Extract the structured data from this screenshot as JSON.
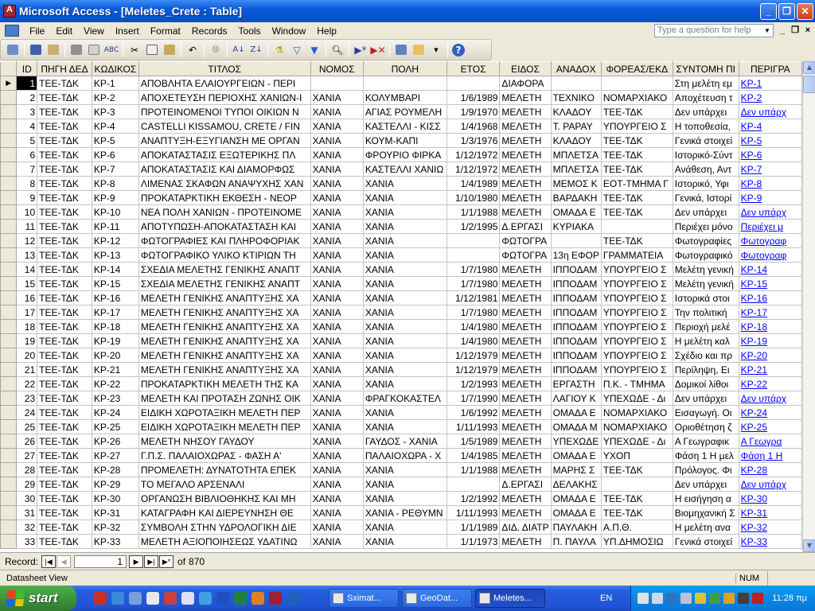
{
  "window": {
    "title": "Microsoft Access - [Meletes_Crete : Table]"
  },
  "menu": {
    "items": [
      "File",
      "Edit",
      "View",
      "Insert",
      "Format",
      "Records",
      "Tools",
      "Window",
      "Help"
    ],
    "ask_placeholder": "Type a question for help"
  },
  "table": {
    "columns": [
      "ID",
      "ΠΗΓΗ ΔΕΔ",
      "ΚΩΔΙΚΟΣ",
      "ΤΙΤΛΟΣ",
      "ΝΟΜΟΣ",
      "ΠΟΛΗ",
      "ΕΤΟΣ",
      "ΕΙΔΟΣ",
      "ΑΝΑΔΟΧ",
      "ΦΟΡΕΑΣ/ΕΚΔ",
      "ΣΥΝΤΟΜΗ ΠΙ",
      "ΠΕΡΙΓΡΑ"
    ],
    "rows": [
      [
        "1",
        "ΤΕΕ-ΤΔΚ",
        "ΚΡ-1",
        "ΑΠΟΒΛΗΤΑ ΕΛΑΙΟΥΡΓΕΙΩΝ - ΠΕΡΙ",
        "",
        "",
        "",
        "ΔΙΑΦΟΡΑ",
        "",
        "",
        "Στη μελέτη εμ",
        "ΚΡ-1"
      ],
      [
        "2",
        "ΤΕΕ-ΤΔΚ",
        "ΚΡ-2",
        "ΑΠΟΧΕΤΕΥΣΗ ΠΕΡΙΟΧΗΣ ΧΑΝΙΩΝ-Ι",
        "ΧΑΝΙΑ",
        "ΚΟΛΥΜΒΑΡΙ",
        "1/6/1989",
        "ΜΕΛΕΤΗ",
        "ΤΕΧΝΙΚΟ",
        "ΝΟΜΑΡΧΙΑΚΟ",
        "Αποχέτευση τ",
        "ΚΡ-2"
      ],
      [
        "3",
        "ΤΕΕ-ΤΔΚ",
        "ΚΡ-3",
        "ΠΡΟΤΕΙΝΟΜΕΝΟΙ ΤΥΠΟΙ ΟΙΚΙΩΝ Ν",
        "ΧΑΝΙΑ",
        "ΑΓΙΑΣ ΡΟΥΜΕΛΗ",
        "1/9/1970",
        "ΜΕΛΕΤΗ",
        "ΚΛΑΔΟΥ",
        "ΤΕΕ-ΤΔΚ",
        "Δεν υπάρχει",
        "Δεν υπάρχ"
      ],
      [
        "4",
        "ΤΕΕ-ΤΔΚ",
        "ΚΡ-4",
        "CASTELLI KISSAMOU, CRETE / FIN",
        "ΧΑΝΙΑ",
        "ΚΑΣΤΕΛΛΙ - ΚΙΣΣ",
        "1/4/1968",
        "ΜΕΛΕΤΗ",
        "Τ. ΡΑΡΑΥ",
        "ΥΠΟΥΡΓΕΙΟ Σ",
        "Η τοποθεσία,",
        "ΚΡ-4"
      ],
      [
        "5",
        "ΤΕΕ-ΤΔΚ",
        "ΚΡ-5",
        "ΑΝΑΠΤΥΞΗ-ΕΞΥΓΙΑΝΣΗ ΜΕ ΟΡΓΑΝ",
        "ΧΑΝΙΑ",
        "ΚΟΥΜ-ΚΑΠΙ",
        "1/3/1976",
        "ΜΕΛΕΤΗ",
        "ΚΛΑΔΟΥ",
        "ΤΕΕ-ΤΔΚ",
        "Γενικά στοιχεί",
        "ΚΡ-5"
      ],
      [
        "6",
        "ΤΕΕ-ΤΔΚ",
        "ΚΡ-6",
        "ΑΠΟΚΑΤΑΣΤΑΣΙΣ ΕΞΩΤΕΡΙΚΗΣ ΠΛ",
        "ΧΑΝΙΑ",
        "ΦΡΟΥΡΙΟ ΦΙΡΚΑ",
        "1/12/1972",
        "ΜΕΛΕΤΗ",
        "ΜΠΛΕΤΣΑ",
        "ΤΕΕ-ΤΔΚ",
        "Ιστορικό-Σύντ",
        "ΚΡ-6"
      ],
      [
        "7",
        "ΤΕΕ-ΤΔΚ",
        "ΚΡ-7",
        "ΑΠΟΚΑΤΑΣΤΑΣΙΣ ΚΑΙ ΔΙΑΜΟΡΦΩΣ",
        "ΧΑΝΙΑ",
        "ΚΑΣΤΕΛΛΙ ΧΑΝΙΩ",
        "1/12/1972",
        "ΜΕΛΕΤΗ",
        "ΜΠΛΕΤΣΑ",
        "ΤΕΕ-ΤΔΚ",
        "Ανάθεση, Αντ",
        "ΚΡ-7"
      ],
      [
        "8",
        "ΤΕΕ-ΤΔΚ",
        "ΚΡ-8",
        "ΛΙΜΕΝΑΣ ΣΚΑΦΩΝ ΑΝΑΨΥΧΗΣ ΧΑΝ",
        "ΧΑΝΙΑ",
        "ΧΑΝΙΑ",
        "1/4/1989",
        "ΜΕΛΕΤΗ",
        "ΜΕΜΟΣ Κ",
        "ΕΟΤ-ΤΜΗΜΑ Γ",
        "Ιστορικό, Υφι",
        "ΚΡ-8"
      ],
      [
        "9",
        "ΤΕΕ-ΤΔΚ",
        "ΚΡ-9",
        "ΠΡΟΚΑΤΑΡΚΤΙΚΗ ΕΚΘΕΣΗ - ΝΕΟΡ",
        "ΧΑΝΙΑ",
        "ΧΑΝΙΑ",
        "1/10/1980",
        "ΜΕΛΕΤΗ",
        "ΒΑΡΔΑΚΗ",
        "ΤΕΕ-ΤΔΚ",
        "Γενικά, Ιστορί",
        "ΚΡ-9"
      ],
      [
        "10",
        "ΤΕΕ-ΤΔΚ",
        "ΚΡ-10",
        "ΝΕΑ ΠΟΛΗ ΧΑΝΙΩΝ - ΠΡΟΤΕΙΝΟΜΕ",
        "ΧΑΝΙΑ",
        "ΧΑΝΙΑ",
        "1/1/1988",
        "ΜΕΛΕΤΗ",
        "ΟΜΑΔΑ Ε",
        "ΤΕΕ-ΤΔΚ",
        "Δεν υπάρχει",
        "Δεν υπάρχ"
      ],
      [
        "11",
        "ΤΕΕ-ΤΔΚ",
        "ΚΡ-11",
        "ΑΠΟΤΥΠΩΣΗ-ΑΠΟΚΑΤΑΣΤΑΣΗ ΚΑΙ",
        "ΧΑΝΙΑ",
        "ΧΑΝΙΑ",
        "1/2/1995",
        "Δ.ΕΡΓΑΣΙ",
        "ΚΥΡΙΑΚΑ",
        "",
        "Περιέχει μόνο",
        "Περιέχει μ"
      ],
      [
        "12",
        "ΤΕΕ-ΤΔΚ",
        "ΚΡ-12",
        "ΦΩΤΟΓΡΑΦΙΕΣ ΚΑΙ ΠΛΗΡΟΦΟΡΙΑΚ",
        "ΧΑΝΙΑ",
        "ΧΑΝΙΑ",
        "",
        "ΦΩΤΟΓΡΑ",
        "",
        "ΤΕΕ-ΤΔΚ",
        "Φωτογραφίες",
        "Φωτογραφ"
      ],
      [
        "13",
        "ΤΕΕ-ΤΔΚ",
        "ΚΡ-13",
        "ΦΩΤΟΓΡΑΦΙΚΟ ΥΛΙΚΟ ΚΤΙΡΙΩΝ ΤΗ",
        "ΧΑΝΙΑ",
        "ΧΑΝΙΑ",
        "",
        "ΦΩΤΟΓΡΑ",
        "13η ΕΦΟΡ",
        "ΓΡΑΜΜΑΤΕΙΑ",
        "Φωτογραφικό",
        "Φωτογραφ"
      ],
      [
        "14",
        "ΤΕΕ-ΤΔΚ",
        "ΚΡ-14",
        "ΣΧΕΔΙΑ ΜΕΛΕΤΗΣ ΓΕΝΙΚΗΣ ΑΝΑΠΤ",
        "ΧΑΝΙΑ",
        "ΧΑΝΙΑ",
        "1/7/1980",
        "ΜΕΛΕΤΗ",
        "ΙΠΠΟΔΑΜ",
        "ΥΠΟΥΡΓΕΙΟ Σ",
        "Μελέτη γενική",
        "ΚΡ-14"
      ],
      [
        "15",
        "ΤΕΕ-ΤΔΚ",
        "ΚΡ-15",
        "ΣΧΕΔΙΑ ΜΕΛΕΤΗΣ ΓΕΝΙΚΗΣ ΑΝΑΠΤ",
        "ΧΑΝΙΑ",
        "ΧΑΝΙΑ",
        "1/7/1980",
        "ΜΕΛΕΤΗ",
        "ΙΠΠΟΔΑΜ",
        "ΥΠΟΥΡΓΕΙΟ Σ",
        "Μελέτη γενική",
        "ΚΡ-15"
      ],
      [
        "16",
        "ΤΕΕ-ΤΔΚ",
        "ΚΡ-16",
        "ΜΕΛΕΤΗ ΓΕΝΙΚΗΣ ΑΝΑΠΤΥΞΗΣ ΧΑ",
        "ΧΑΝΙΑ",
        "ΧΑΝΙΑ",
        "1/12/1981",
        "ΜΕΛΕΤΗ",
        "ΙΠΠΟΔΑΜ",
        "ΥΠΟΥΡΓΕΙΟ Σ",
        "Ιστορικά στοι",
        "ΚΡ-16"
      ],
      [
        "17",
        "ΤΕΕ-ΤΔΚ",
        "ΚΡ-17",
        "ΜΕΛΕΤΗ ΓΕΝΙΚΗΣ ΑΝΑΠΤΥΞΗΣ ΧΑ",
        "ΧΑΝΙΑ",
        "ΧΑΝΙΑ",
        "1/7/1980",
        "ΜΕΛΕΤΗ",
        "ΙΠΠΟΔΑΜ",
        "ΥΠΟΥΡΓΕΙΟ Σ",
        "Την πολιτική",
        "ΚΡ-17"
      ],
      [
        "18",
        "ΤΕΕ-ΤΔΚ",
        "ΚΡ-18",
        "ΜΕΛΕΤΗ ΓΕΝΙΚΗΣ ΑΝΑΠΤΥΞΗΣ ΧΑ",
        "ΧΑΝΙΑ",
        "ΧΑΝΙΑ",
        "1/4/1980",
        "ΜΕΛΕΤΗ",
        "ΙΠΠΟΔΑΜ",
        "ΥΠΟΥΡΓΕΙΟ Σ",
        "Περιοχή μελέ",
        "ΚΡ-18"
      ],
      [
        "19",
        "ΤΕΕ-ΤΔΚ",
        "ΚΡ-19",
        "ΜΕΛΕΤΗ ΓΕΝΙΚΗΣ ΑΝΑΠΤΥΞΗΣ ΧΑ",
        "ΧΑΝΙΑ",
        "ΧΑΝΙΑ",
        "1/4/1980",
        "ΜΕΛΕΤΗ",
        "ΙΠΠΟΔΑΜ",
        "ΥΠΟΥΡΓΕΙΟ Σ",
        "Η μελέτη καλ",
        "ΚΡ-19"
      ],
      [
        "20",
        "ΤΕΕ-ΤΔΚ",
        "ΚΡ-20",
        "ΜΕΛΕΤΗ ΓΕΝΙΚΗΣ ΑΝΑΠΤΥΞΗΣ ΧΑ",
        "ΧΑΝΙΑ",
        "ΧΑΝΙΑ",
        "1/12/1979",
        "ΜΕΛΕΤΗ",
        "ΙΠΠΟΔΑΜ",
        "ΥΠΟΥΡΓΕΙΟ Σ",
        "Σχέδιο και πρ",
        "ΚΡ-20"
      ],
      [
        "21",
        "ΤΕΕ-ΤΔΚ",
        "ΚΡ-21",
        "ΜΕΛΕΤΗ ΓΕΝΙΚΗΣ ΑΝΑΠΤΥΞΗΣ ΧΑ",
        "ΧΑΝΙΑ",
        "ΧΑΝΙΑ",
        "1/12/1979",
        "ΜΕΛΕΤΗ",
        "ΙΠΠΟΔΑΜ",
        "ΥΠΟΥΡΓΕΙΟ Σ",
        "Περίληψη, Ει",
        "ΚΡ-21"
      ],
      [
        "22",
        "ΤΕΕ-ΤΔΚ",
        "ΚΡ-22",
        "ΠΡΟΚΑΤΑΡΚΤΙΚΗ ΜΕΛΕΤΗ ΤΗΣ ΚΑ",
        "ΧΑΝΙΑ",
        "ΧΑΝΙΑ",
        "1/2/1993",
        "ΜΕΛΕΤΗ",
        "ΕΡΓΑΣΤΗ",
        "Π.Κ. - ΤΜΗΜΑ",
        "Δομικοί λίθοι",
        "ΚΡ-22"
      ],
      [
        "23",
        "ΤΕΕ-ΤΔΚ",
        "ΚΡ-23",
        "ΜΕΛΕΤΗ ΚΑΙ ΠΡΟΤΑΣΗ ΖΩΝΗΣ ΟΙΚ",
        "ΧΑΝΙΑ",
        "ΦΡΑΓΚΟΚΑΣΤΕΛ",
        "1/7/1990",
        "ΜΕΛΕΤΗ",
        "ΛΑΓΙΟΥ Κ",
        "ΥΠΕΧΩΔΕ - Δι",
        "Δεν υπάρχει",
        "Δεν υπάρχ"
      ],
      [
        "24",
        "ΤΕΕ-ΤΔΚ",
        "ΚΡ-24",
        "ΕΙΔΙΚΗ ΧΩΡΟΤΑΞΙΚΗ ΜΕΛΕΤΗ ΠΕΡ",
        "ΧΑΝΙΑ",
        "ΧΑΝΙΑ",
        "1/6/1992",
        "ΜΕΛΕΤΗ",
        "ΟΜΑΔΑ Ε",
        "ΝΟΜΑΡΧΙΑΚΟ",
        "Εισαγωγή. Οι",
        "ΚΡ-24"
      ],
      [
        "25",
        "ΤΕΕ-ΤΔΚ",
        "ΚΡ-25",
        "ΕΙΔΙΚΗ ΧΩΡΟΤΑΞΙΚΗ ΜΕΛΕΤΗ ΠΕΡ",
        "ΧΑΝΙΑ",
        "ΧΑΝΙΑ",
        "1/11/1993",
        "ΜΕΛΕΤΗ",
        "ΟΜΑΔΑ Μ",
        "ΝΟΜΑΡΧΙΑΚΟ",
        "Οριοθέτηση ζ",
        "ΚΡ-25"
      ],
      [
        "26",
        "ΤΕΕ-ΤΔΚ",
        "ΚΡ-26",
        "ΜΕΛΕΤΗ ΝΗΣΟΥ ΓΑΥΔΟΥ",
        "ΧΑΝΙΑ",
        "ΓΑΥΔΟΣ - ΧΑΝΙΑ",
        "1/5/1989",
        "ΜΕΛΕΤΗ",
        "ΥΠΕΧΩΔΕ",
        "ΥΠΕΧΩΔΕ - Δι",
        "Α Γεωγραφικ",
        "Α Γεωγρα"
      ],
      [
        "27",
        "ΤΕΕ-ΤΔΚ",
        "ΚΡ-27",
        "Γ.Π.Σ. ΠΑΛΑΙΟΧΩΡΑΣ - ΦΑΣΗ Α'",
        "ΧΑΝΙΑ",
        "ΠΑΛΑΙΟΧΩΡΑ - Χ",
        "1/4/1985",
        "ΜΕΛΕΤΗ",
        "ΟΜΑΔΑ Ε",
        "ΥΧΟΠ",
        "Φάση 1 Η μελ",
        "Φάση 1 Η"
      ],
      [
        "28",
        "ΤΕΕ-ΤΔΚ",
        "ΚΡ-28",
        "ΠΡΟΜΕΛΕΤΗ: ΔΥΝΑΤΟΤΗΤΑ ΕΠΕΚ",
        "ΧΑΝΙΑ",
        "ΧΑΝΙΑ",
        "1/1/1988",
        "ΜΕΛΕΤΗ",
        "ΜΑΡΗΣ Σ",
        "ΤΕΕ-ΤΔΚ",
        "Πρόλογος. Φι",
        "ΚΡ-28"
      ],
      [
        "29",
        "ΤΕΕ-ΤΔΚ",
        "ΚΡ-29",
        "ΤΟ ΜΕΓΑΛΟ ΑΡΣΕΝΑΛΙ",
        "ΧΑΝΙΑ",
        "ΧΑΝΙΑ",
        "",
        "Δ.ΕΡΓΑΣΙ",
        "ΔΕΛΑΚΗΣ",
        "",
        "Δεν υπάρχει",
        "Δεν υπάρχ"
      ],
      [
        "30",
        "ΤΕΕ-ΤΔΚ",
        "ΚΡ-30",
        "ΟΡΓΑΝΩΣΗ ΒΙΒΛΙΟΘΗΚΗΣ ΚΑΙ ΜΗ",
        "ΧΑΝΙΑ",
        "ΧΑΝΙΑ",
        "1/2/1992",
        "ΜΕΛΕΤΗ",
        "ΟΜΑΔΑ Ε",
        "ΤΕΕ-ΤΔΚ",
        "Η εισήγηση α",
        "ΚΡ-30"
      ],
      [
        "31",
        "ΤΕΕ-ΤΔΚ",
        "ΚΡ-31",
        "ΚΑΤΑΓΡΑΦΗ ΚΑΙ ΔΙΕΡΕΥΝΗΣΗ ΘΕ",
        "ΧΑΝΙΑ",
        "ΧΑΝΙΑ - ΡΕΘΥΜΝ",
        "1/11/1993",
        "ΜΕΛΕΤΗ",
        "ΟΜΑΔΑ Ε",
        "ΤΕΕ-ΤΔΚ",
        "Βιομηχανική Σ",
        "ΚΡ-31"
      ],
      [
        "32",
        "ΤΕΕ-ΤΔΚ",
        "ΚΡ-32",
        "ΣΥΜΒΟΛΗ ΣΤΗΝ ΥΔΡΟΛΟΓΙΚΗ ΔΙΕ",
        "ΧΑΝΙΑ",
        "ΧΑΝΙΑ",
        "1/1/1989",
        "ΔΙΔ. ΔΙΑΤΡ",
        "ΠΑΥΛΑΚΗ",
        "Α.Π.Θ.",
        "Η μελέτη ανα",
        "ΚΡ-32"
      ],
      [
        "33",
        "ΤΕΕ-ΤΔΚ",
        "ΚΡ-33",
        "ΜΕΛΕΤΗ ΑΞΙΟΠΟΙΗΣΕΩΣ ΥΔΑΤΙΝΩ",
        "ΧΑΝΙΑ",
        "ΧΑΝΙΑ",
        "1/1/1973",
        "ΜΕΛΕΤΗ",
        "Π. ΠΑΥΛΑ",
        "ΥΠ.ΔΗΜΟΣΙΩ",
        "Γενικά στοιχεί",
        "ΚΡ-33"
      ]
    ]
  },
  "record_nav": {
    "label": "Record:",
    "current": "1",
    "of_label": "of",
    "total": "870"
  },
  "status": {
    "text": "Datasheet View",
    "num": "NUM"
  },
  "taskbar": {
    "start": "start",
    "tasks": [
      "Sximat...",
      "GeoDat...",
      "Meletes..."
    ],
    "lang": "EN",
    "clock": "11:28 πμ"
  }
}
